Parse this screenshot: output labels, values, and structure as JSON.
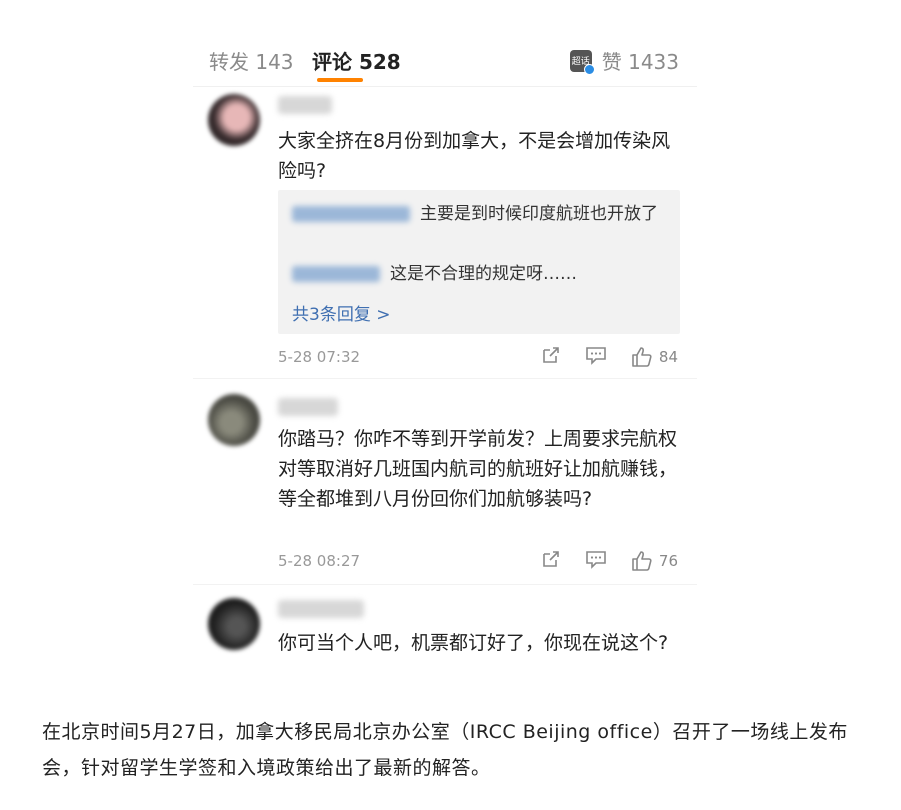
{
  "tabs": {
    "repost": "转发 143",
    "comments": "评论 528",
    "likes": "赞 1433",
    "avatar_text": "超话"
  },
  "comments": [
    {
      "text": "大家全挤在8月份到加拿大，不是会增加传染风险吗?",
      "replies": [
        {
          "text": "主要是到时候印度航班也开放了"
        },
        {
          "text": "这是不合理的规定呀……"
        }
      ],
      "more_replies": "共3条回复 >",
      "time": "5-28 07:32",
      "likes": "84"
    },
    {
      "text": "你踏马？你咋不等到开学前发？上周要求完航权对等取消好几班国内航司的航班好让加航赚钱，等全都堆到八月份回你们加航够装吗?",
      "time": "5-28 08:27",
      "likes": "76"
    },
    {
      "text": "你可当个人吧，机票都订好了，你现在说这个?"
    }
  ],
  "caption": "在北京时间5月27日，加拿大移民局北京办公室（IRCC Beijing office）召开了一场线上发布会，针对留学生学签和入境政策给出了最新的解答。",
  "colors": {
    "accent": "#ff8200",
    "link": "#3f6fb1"
  }
}
